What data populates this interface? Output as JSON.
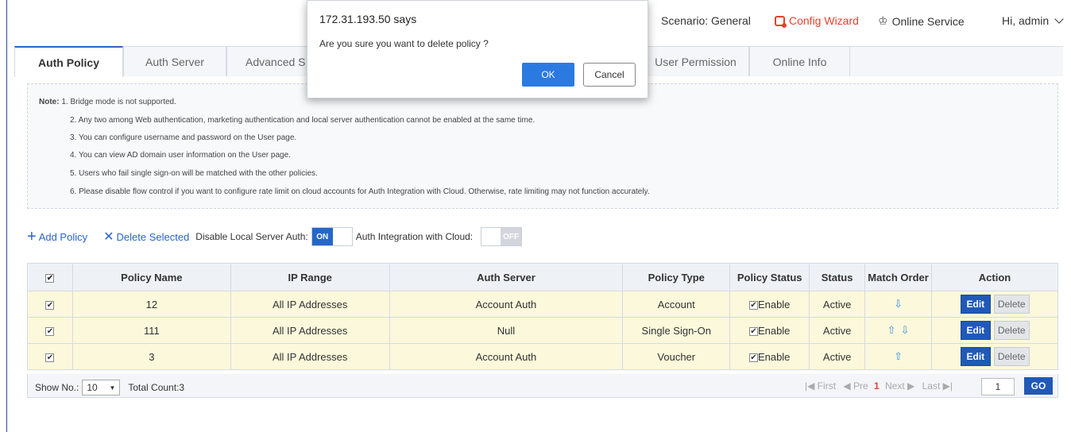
{
  "header": {
    "scenario": "Scenario:  General",
    "config_wizard": "Config Wizard",
    "online_service": "Online Service",
    "user": "Hi, admin"
  },
  "tabs": [
    "Auth Policy",
    "Auth Server",
    "Advanced S",
    "",
    "User Permission",
    "Online Info"
  ],
  "note": {
    "label": "Note:",
    "lines": [
      "1. Bridge mode is not supported.",
      "2. Any two among Web authentication, marketing authentication and local server authentication cannot be enabled at the same time.",
      "3. You can configure username and password on the User page.",
      "4. You can view AD domain user information on the User page.",
      "5. Users who fail single sign-on will be matched with the other policies.",
      "6. Please disable flow control if you want to configure rate limit on cloud accounts for Auth Integration with Cloud. Otherwise, rate limiting may not function accurately."
    ]
  },
  "toolbar": {
    "add_policy": "Add Policy",
    "delete_selected": "Delete Selected",
    "disable_local_label": "Disable Local Server Auth:",
    "disable_local_state": "ON",
    "cloud_label": "Auth Integration with Cloud:",
    "cloud_state": "OFF"
  },
  "table": {
    "columns": [
      "Policy Name",
      "IP Range",
      "Auth Server",
      "Policy Type",
      "Policy Status",
      "Status",
      "Match Order",
      "Action"
    ],
    "rows": [
      {
        "name": "12",
        "ip_range": "All IP Addresses",
        "auth_server": "Account Auth",
        "type": "Account",
        "policy_status": "Enable",
        "status": "Active",
        "order": [
          "down"
        ]
      },
      {
        "name": "111",
        "ip_range": "All IP Addresses",
        "auth_server": "Null",
        "type": "Single Sign-On",
        "policy_status": "Enable",
        "status": "Active",
        "order": [
          "up",
          "down"
        ]
      },
      {
        "name": "3",
        "ip_range": "All IP Addresses",
        "auth_server": "Account Auth",
        "type": "Voucher",
        "policy_status": "Enable",
        "status": "Active",
        "order": [
          "up"
        ]
      }
    ],
    "edit_label": "Edit",
    "delete_label": "Delete"
  },
  "pager": {
    "show_no_label": "Show No.:",
    "show_no_value": "10",
    "total": "Total Count:3",
    "first": "First",
    "pre": "Pre",
    "current": "1",
    "next": "Next",
    "last": "Last",
    "page_input": "1",
    "go": "GO"
  },
  "dialog": {
    "title": "172.31.193.50 says",
    "message": "Are you sure you want to  delete policy ?",
    "ok": "OK",
    "cancel": "Cancel"
  }
}
